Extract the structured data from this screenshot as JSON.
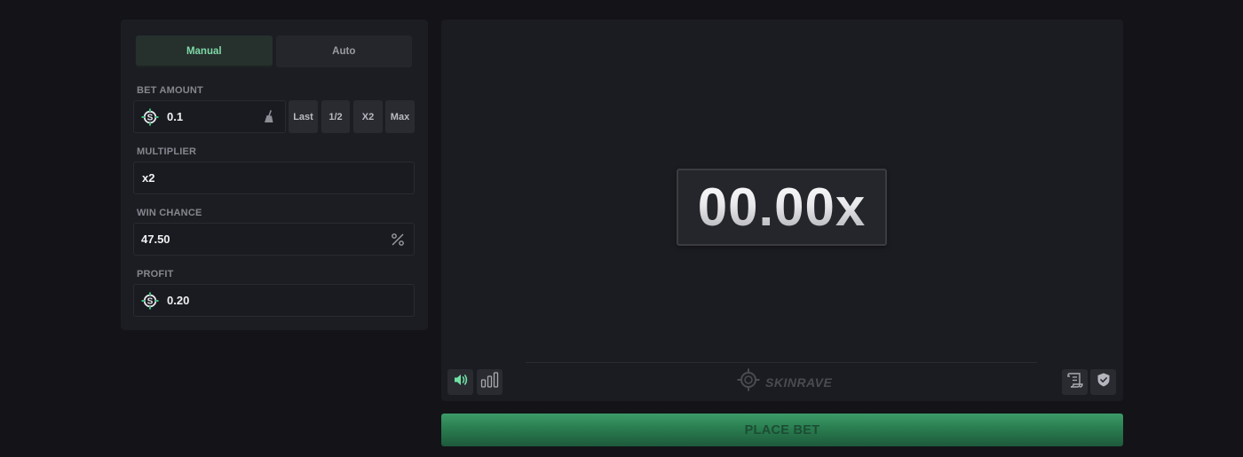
{
  "mode_tabs": {
    "manual": "Manual",
    "auto": "Auto",
    "active": "manual"
  },
  "bet_amount": {
    "label": "BET AMOUNT",
    "value": "0.1",
    "currency_icon": "skinrave-coin-icon",
    "clear_icon": "broom-icon",
    "quick_buttons": [
      "Last",
      "1/2",
      "X2",
      "Max"
    ]
  },
  "multiplier": {
    "label": "MULTIPLIER",
    "value": "x2"
  },
  "win_chance": {
    "label": "WIN CHANCE",
    "value": "47.50",
    "suffix_icon": "percent-icon"
  },
  "profit": {
    "label": "PROFIT",
    "value": "0.20",
    "currency_icon": "skinrave-coin-icon"
  },
  "game": {
    "multiplier_display": "00.00x",
    "brand": "SKINRAVE",
    "controls": {
      "sound_icon": "speaker-icon",
      "stats_icon": "bar-chart-icon",
      "history_icon": "scroll-icon",
      "fairness_icon": "shield-icon"
    }
  },
  "place_bet": {
    "label": "PLACE BET"
  },
  "colors": {
    "background": "#131318",
    "panel": "#1c1d23",
    "accent_green": "#2a7d50",
    "active_tab_text": "#7fd9a6"
  }
}
